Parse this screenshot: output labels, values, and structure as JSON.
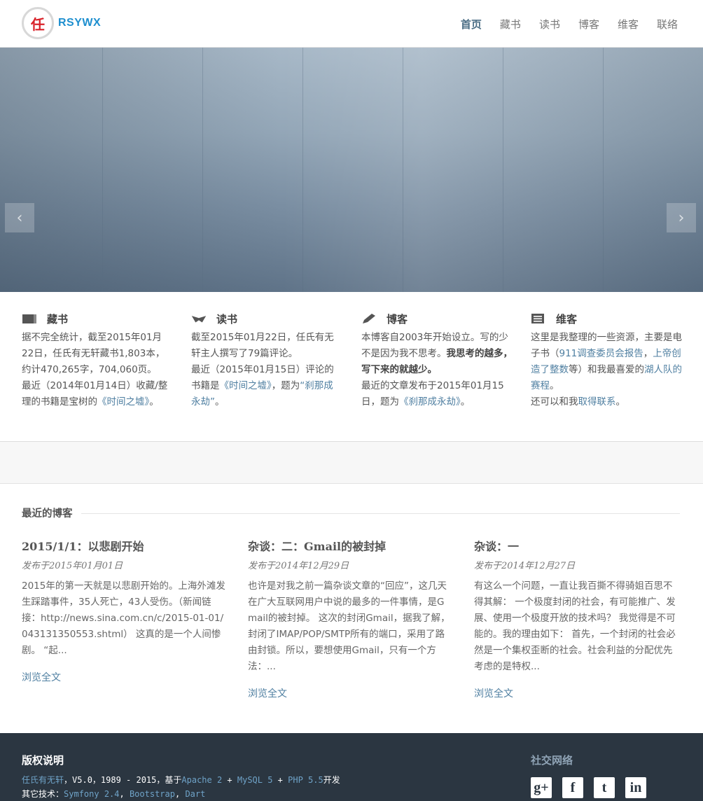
{
  "header": {
    "logo_char": "任",
    "brand": "RSYWX",
    "nav": [
      "首页",
      "藏书",
      "读书",
      "博客",
      "维客",
      "联络"
    ]
  },
  "slider": {
    "prev": "‹",
    "next": "›"
  },
  "features": {
    "collection": {
      "title": "藏书",
      "p1": "据不完全统计，截至2015年01月22日，任氏有无轩藏书1,803本，约计470,265字，704,060页。",
      "p2_pre": "最近（2014年01月14日）收藏/整理的书籍是宝树的",
      "p2_link": "《时间之墟》",
      "p2_post": "。"
    },
    "reading": {
      "title": "读书",
      "p1": "截至2015年01月22日，任氏有无轩主人撰写了79篇评论。",
      "p2_pre": "最近（2015年01月15日）评论的书籍是",
      "p2_link1": "《时间之墟》",
      "p2_mid": "，题为",
      "p2_link2": "“刹那成永劫”",
      "p2_post": "。"
    },
    "blog": {
      "title": "博客",
      "p1_pre": "本博客自2003年开始设立。写的少不是因为我不思考。",
      "p1_bold": "我思考的越多，写下来的就越少。",
      "p2_pre": "最近的文章发布于2015年01月15日，题为",
      "p2_link": "《刹那成永劫》",
      "p2_post": "。"
    },
    "wiki": {
      "title": "维客",
      "p1_pre": "这里是我整理的一些资源，主要是电子书（",
      "link1": "911调查委员会报告",
      "sep": "，",
      "link2": "上帝创造了整数",
      "p1_mid": "等）和我最喜爱的",
      "link3": "湖人队的赛程",
      "p1_post": "。",
      "p2_pre": "还可以和我",
      "p2_link": "取得联系",
      "p2_post": "。"
    }
  },
  "recent": {
    "title": "最近的博客",
    "posts": [
      {
        "title": "2015/1/1：以悲剧开始",
        "date": "发布于2015年01月01日",
        "excerpt": "2015年的第一天就是以悲剧开始的。上海外滩发生踩踏事件，35人死亡，43人受伤。（新闻链接：http://news.sina.com.cn/c/2015-01-01/043131350553.shtml） 这真的是一个人间惨剧。 “起...",
        "more": "浏览全文"
      },
      {
        "title": "杂谈：二：Gmail的被封掉",
        "date": "发布于2014年12月29日",
        "excerpt": "也许是对我之前一篇杂谈文章的“回应”，这几天在广大互联网用户中说的最多的一件事情，是Gmail的被封掉。 这次的封闭Gmail，据我了解，封闭了IMAP/POP/SMTP所有的端口，采用了路由封锁。所以，要想使用Gmail，只有一个方法：...",
        "more": "浏览全文"
      },
      {
        "title": "杂谈：一",
        "date": "发布于2014年12月27日",
        "excerpt": "有这么一个问题，一直让我百撕不得骑姐百思不得其解： 一个极度封闭的社会，有可能推广、发展、使用一个极度开放的技术吗？ 我觉得是不可能的。我的理由如下： 首先，一个封闭的社会必然是一个集权歪断的社会。社会利益的分配优先考虑的是特权...",
        "more": "浏览全文"
      }
    ]
  },
  "footer": {
    "title": "版权说明",
    "line1_link": "任氏有无轩",
    "line1_mid": "，V5.0，1989 - 2015，基于",
    "tech1": "Apache 2",
    "plus": " + ",
    "tech2": "MySQL 5",
    "tech3": "PHP 5.5",
    "line1_post": "开发",
    "line2_pre": "其它技术：",
    "tech4": "Symfony 2.4",
    "comma": ", ",
    "tech5": "Bootstrap",
    "tech6": "Dart",
    "social_title": "社交网络",
    "social": [
      "g+",
      "f",
      "t",
      "in"
    ]
  }
}
